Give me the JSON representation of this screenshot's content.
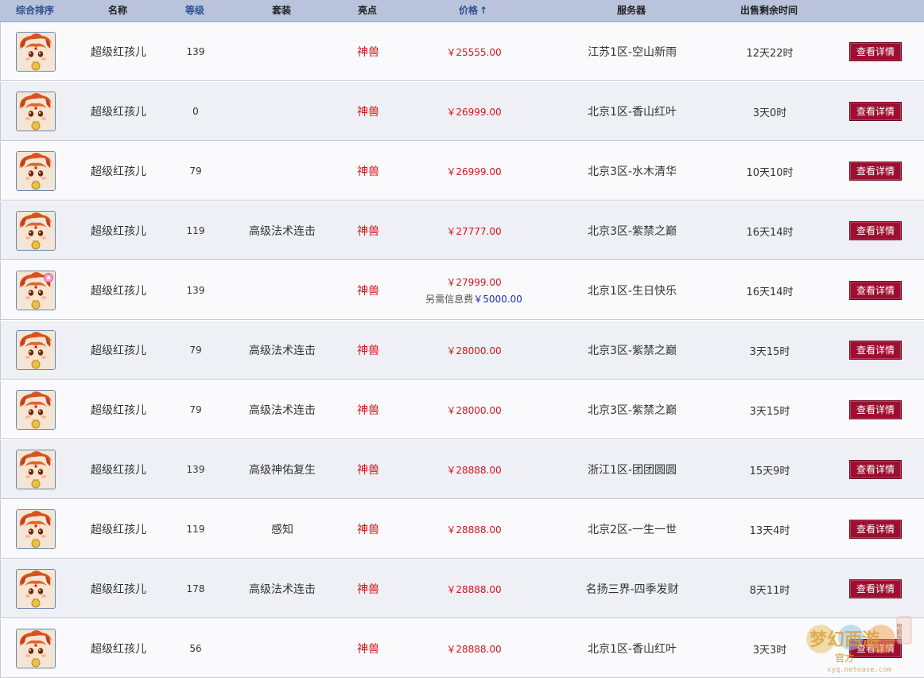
{
  "header": {
    "rank": "综合排序",
    "name": "名称",
    "level": "等级",
    "suit": "套装",
    "highlight": "亮点",
    "price": "价格",
    "price_arrow": "↑",
    "server": "服务器",
    "time_left": "出售剩余时间"
  },
  "rows": [
    {
      "name": "超级红孩儿",
      "level": "139",
      "suit": "",
      "highlight": "神兽",
      "price": "￥25555.00",
      "server": "江苏1区-空山新雨",
      "time_left": "12天22时",
      "action": "查看详情"
    },
    {
      "name": "超级红孩儿",
      "level": "0",
      "suit": "",
      "highlight": "神兽",
      "price": "￥26999.00",
      "server": "北京1区-香山红叶",
      "time_left": "3天0时",
      "action": "查看详情"
    },
    {
      "name": "超级红孩儿",
      "level": "79",
      "suit": "",
      "highlight": "神兽",
      "price": "￥26999.00",
      "server": "北京3区-水木清华",
      "time_left": "10天10时",
      "action": "查看详情"
    },
    {
      "name": "超级红孩儿",
      "level": "119",
      "suit": "高级法术连击",
      "highlight": "神兽",
      "price": "￥27777.00",
      "server": "北京3区-紫禁之巅",
      "time_left": "16天14时",
      "action": "查看详情"
    },
    {
      "name": "超级红孩儿",
      "level": "139",
      "suit": "",
      "highlight": "神兽",
      "price": "￥27999.00",
      "fee_label": "另需信息费",
      "fee_value": "￥5000.00",
      "server": "北京1区-生日快乐",
      "time_left": "16天14时",
      "action": "查看详情"
    },
    {
      "name": "超级红孩儿",
      "level": "79",
      "suit": "高级法术连击",
      "highlight": "神兽",
      "price": "￥28000.00",
      "server": "北京3区-紫禁之巅",
      "time_left": "3天15时",
      "action": "查看详情"
    },
    {
      "name": "超级红孩儿",
      "level": "79",
      "suit": "高级法术连击",
      "highlight": "神兽",
      "price": "￥28000.00",
      "server": "北京3区-紫禁之巅",
      "time_left": "3天15时",
      "action": "查看详情"
    },
    {
      "name": "超级红孩儿",
      "level": "139",
      "suit": "高级神佑复生",
      "highlight": "神兽",
      "price": "￥28888.00",
      "server": "浙江1区-团团圆圆",
      "time_left": "15天9时",
      "action": "查看详情"
    },
    {
      "name": "超级红孩儿",
      "level": "119",
      "suit": "感知",
      "highlight": "神兽",
      "price": "￥28888.00",
      "server": "北京2区-一生一世",
      "time_left": "13天4时",
      "action": "查看详情"
    },
    {
      "name": "超级红孩儿",
      "level": "178",
      "suit": "高级法术连击",
      "highlight": "神兽",
      "price": "￥28888.00",
      "server": "名扬三界-四季发财",
      "time_left": "8天11时",
      "action": "查看详情"
    },
    {
      "name": "超级红孩儿",
      "level": "56",
      "suit": "",
      "highlight": "神兽",
      "price": "￥28888.00",
      "server": "北京1区-香山红叶",
      "time_left": "3天3时",
      "action": "查看详情"
    }
  ],
  "watermark": {
    "url": "xyq.netease.com",
    "logo_text": "梦幻西游",
    "badge": "电脑版",
    "sub": "官方"
  },
  "colors": {
    "header_bg": "#b9c3dc",
    "sort_link": "#2a4f8f",
    "price_red": "#d4151c",
    "fee_blue": "#1a2fb5",
    "button_bg": "#9d0f31"
  },
  "icons": {
    "avatar": "red-boy-avatar-icon",
    "avatar_badge": "pink-flower-badge-icon"
  }
}
